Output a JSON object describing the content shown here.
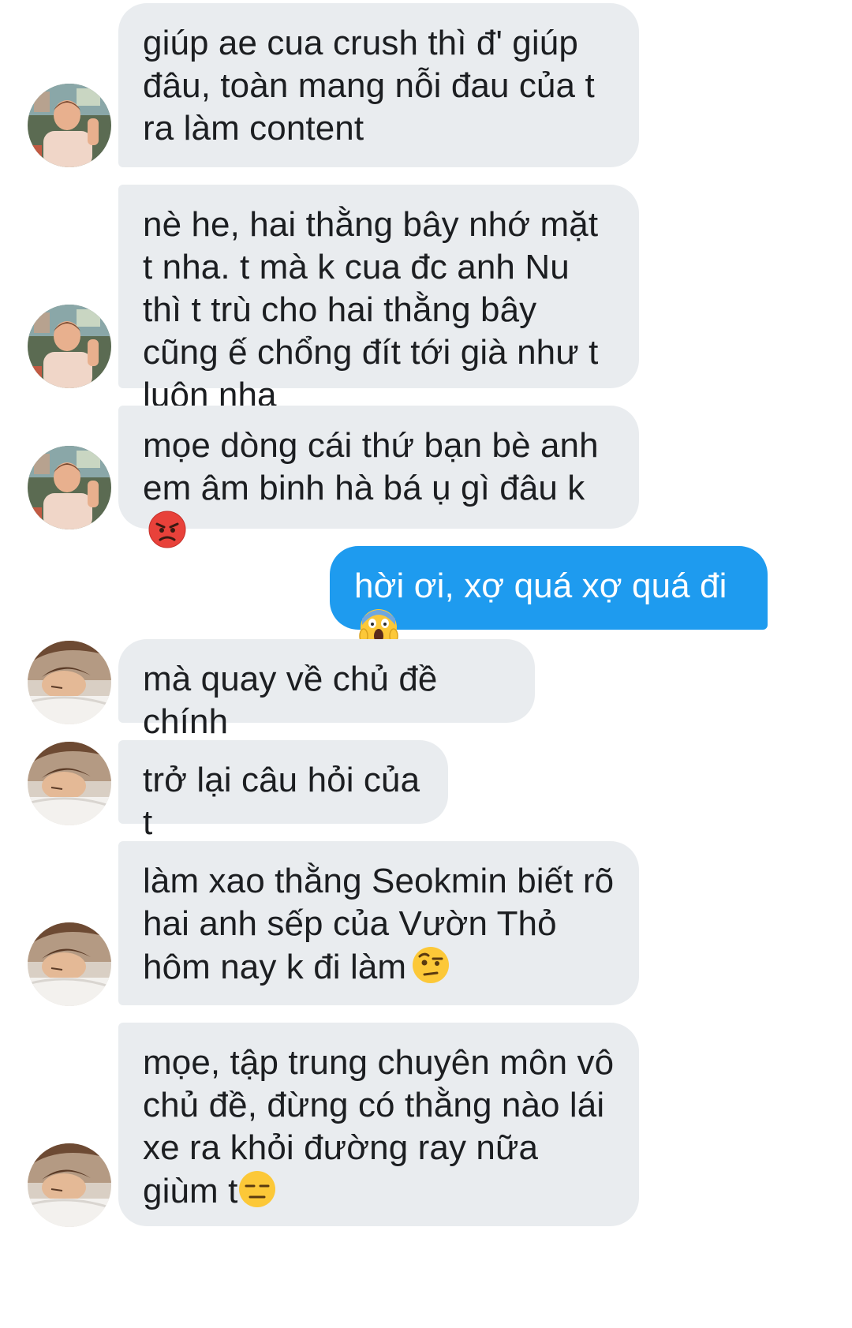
{
  "conversation": {
    "messages": [
      {
        "sender": "them",
        "avatar": "friend-a",
        "text": "giúp ae cua crush thì đ' giúp đâu, toàn mang nỗi đau của t ra làm content"
      },
      {
        "sender": "them",
        "avatar": "friend-a",
        "text": "nè he, hai thằng bây nhớ mặt t nha. t mà k cua đc anh Nu thì t trù cho hai thằng bây cũng ế chổng đít tới già như t luôn nha"
      },
      {
        "sender": "them",
        "avatar": "friend-a",
        "text": "mọe dòng cái thứ bạn bè anh em âm binh hà bá ụ gì đâu k",
        "emoji": "pouting-face-emoji"
      },
      {
        "sender": "me",
        "text": "hời ơi, xợ quá xợ quá đi",
        "emoji": "face-screaming-in-fear-emoji"
      },
      {
        "sender": "them",
        "avatar": "friend-b",
        "text": "mà quay về chủ đề chính"
      },
      {
        "sender": "them",
        "avatar": "friend-b",
        "text": "trở lại câu hỏi của t"
      },
      {
        "sender": "them",
        "avatar": "friend-b",
        "text": "làm xao thằng Seokmin biết rõ hai anh sếp của Vườn Thỏ hôm nay k đi làm",
        "emoji": "face-with-raised-eyebrow-emoji"
      },
      {
        "sender": "them",
        "avatar": "friend-b",
        "text": "mọe, tập trung chuyên môn vô chủ đề, đừng có thằng nào lái xe ra khỏi đường ray nữa giùm t",
        "emoji": "expressionless-face-emoji"
      }
    ]
  },
  "colors": {
    "incoming_bubble": "#e9ecef",
    "outgoing_bubble": "#1e9bef",
    "text": "#1c1e21",
    "outgoing_text": "#ffffff"
  }
}
